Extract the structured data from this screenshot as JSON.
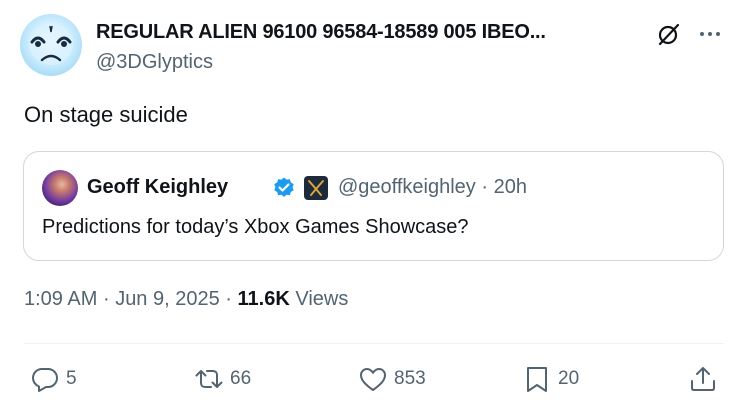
{
  "author": {
    "display_name": "REGULAR ALIEN 96100 96584-18589 005 IBEO...",
    "handle": "@3DGlyptics",
    "avatar_icon": "alien-face-avatar"
  },
  "tweet": {
    "text": "On stage suicide"
  },
  "quoted": {
    "display_name": "Geoff Keighley",
    "handle": "@geoffkeighley",
    "separator": "·",
    "age": "20h",
    "text": "Predictions for today’s Xbox Games Showcase?",
    "verified_color": "#1d9bf0"
  },
  "meta": {
    "time": "1:09 AM",
    "dot1": "·",
    "date": "Jun 9, 2025",
    "dot2": "·",
    "views_count": "11.6K",
    "views_label": "Views"
  },
  "actions": {
    "replies": "5",
    "reposts": "66",
    "likes": "853",
    "bookmarks": "20"
  },
  "colors": {
    "text": "#0f1419",
    "secondary": "#536471",
    "border": "#cfd9de",
    "accent": "#1d9bf0"
  }
}
